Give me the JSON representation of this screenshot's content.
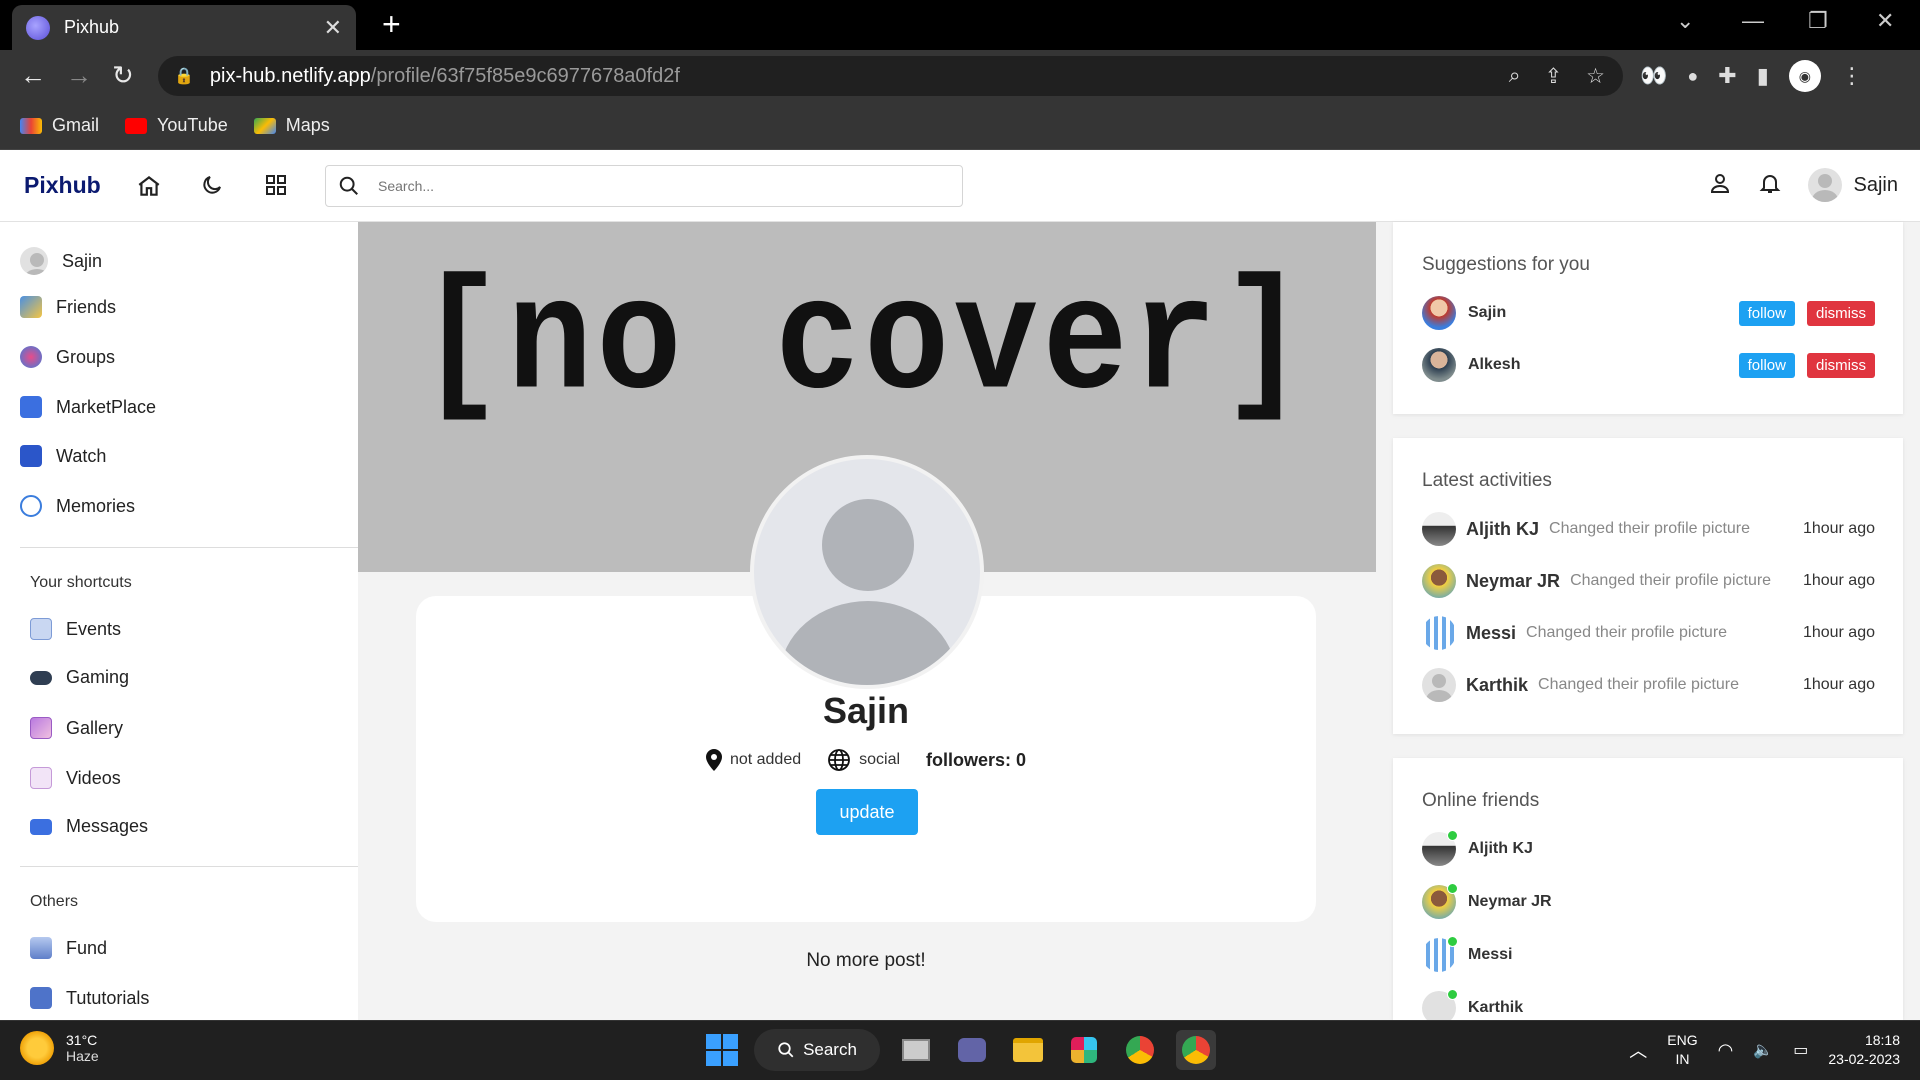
{
  "browser": {
    "tab_title": "Pixhub",
    "url_host": "pix-hub.netlify.app",
    "url_path": "/profile/63f75f85e9c6977678a0fd2f",
    "bookmarks": [
      {
        "label": "Gmail",
        "color": "#ea4335"
      },
      {
        "label": "YouTube",
        "color": "#ff0000"
      },
      {
        "label": "Maps",
        "color": "#34a853"
      }
    ]
  },
  "app": {
    "logo": "Pixhub",
    "search_placeholder": "Search...",
    "user_name": "Sajin",
    "accent": "#1da1f2",
    "danger": "#e0353f"
  },
  "sidebar": {
    "user": "Sajin",
    "items": [
      {
        "label": "Friends",
        "icon": "friends-icon"
      },
      {
        "label": "Groups",
        "icon": "groups-icon"
      },
      {
        "label": "MarketPlace",
        "icon": "marketplace-icon"
      },
      {
        "label": "Watch",
        "icon": "watch-icon"
      },
      {
        "label": "Memories",
        "icon": "memories-icon"
      }
    ],
    "shortcuts_heading": "Your shortcuts",
    "shortcuts": [
      {
        "label": "Events",
        "icon": "events-icon"
      },
      {
        "label": "Gaming",
        "icon": "gaming-icon"
      },
      {
        "label": "Gallery",
        "icon": "gallery-icon"
      },
      {
        "label": "Videos",
        "icon": "videos-icon"
      },
      {
        "label": "Messages",
        "icon": "messages-icon"
      }
    ],
    "others_heading": "Others",
    "others": [
      {
        "label": "Fund",
        "icon": "fund-icon"
      },
      {
        "label": "Tututorials",
        "icon": "tutorials-icon"
      }
    ]
  },
  "profile": {
    "cover_text": "[no cover]",
    "name": "Sajin",
    "location": "not added",
    "website": "social",
    "followers": "followers: 0",
    "update_label": "update",
    "no_more_posts": "No more post!"
  },
  "suggestions": {
    "title": "Suggestions for you",
    "follow_label": "follow",
    "dismiss_label": "dismiss",
    "people": [
      {
        "name": "Sajin"
      },
      {
        "name": "Alkesh"
      }
    ]
  },
  "activities": {
    "title": "Latest activities",
    "items": [
      {
        "name": "Aljith KJ",
        "text": "Changed their profile picture",
        "time": "1hour ago"
      },
      {
        "name": "Neymar JR",
        "text": "Changed their profile picture",
        "time": "1hour ago"
      },
      {
        "name": "Messi",
        "text": "Changed their profile picture",
        "time": "1hour ago"
      },
      {
        "name": "Karthik",
        "text": "Changed their profile picture",
        "time": "1hour ago"
      }
    ]
  },
  "online": {
    "title": "Online friends",
    "friends": [
      {
        "name": "Aljith KJ"
      },
      {
        "name": "Neymar JR"
      },
      {
        "name": "Messi"
      },
      {
        "name": "Karthik"
      }
    ]
  },
  "taskbar": {
    "temp": "31°C",
    "weather": "Haze",
    "search_label": "Search",
    "lang_top": "ENG",
    "lang_bottom": "IN",
    "time": "18:18",
    "date": "23-02-2023"
  }
}
